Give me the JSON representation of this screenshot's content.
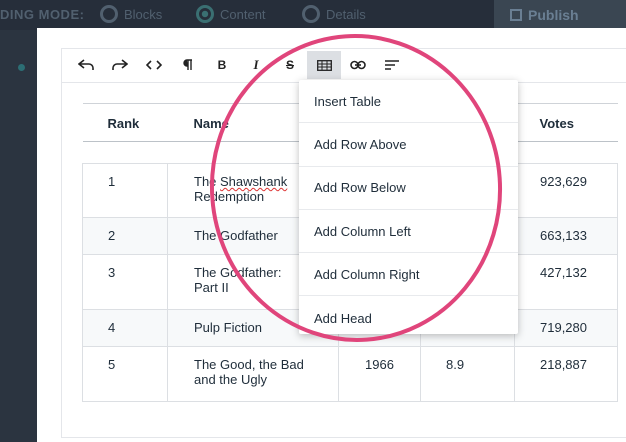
{
  "topbar": {
    "mode_label": "DING MODE:",
    "modes": [
      "Blocks",
      "Content",
      "Details"
    ],
    "publish_label": "Publish"
  },
  "toolbar": {
    "buttons": [
      {
        "name": "undo-icon"
      },
      {
        "name": "redo-icon"
      },
      {
        "name": "code-icon"
      },
      {
        "name": "paragraph-icon"
      },
      {
        "name": "bold-icon",
        "glyph": "B"
      },
      {
        "name": "italic-icon",
        "glyph": "I"
      },
      {
        "name": "strikethrough-icon",
        "glyph": "S"
      },
      {
        "name": "table-icon",
        "active": true
      },
      {
        "name": "link-icon"
      },
      {
        "name": "align-icon"
      }
    ]
  },
  "table": {
    "headers": [
      "Rank",
      "Name",
      "",
      "",
      "Votes"
    ],
    "rows": [
      {
        "rank": "1",
        "name_a": "The ",
        "name_b": "Shawshank",
        "name_c": "Redemption",
        "year": "",
        "rating": "",
        "votes": "923,629"
      },
      {
        "rank": "2",
        "name": "The Godfather",
        "year": "",
        "rating": "",
        "votes": "663,133"
      },
      {
        "rank": "3",
        "name_1": "The Godfather:",
        "name_2": "Part II",
        "year": "",
        "rating": "",
        "votes": "427,132"
      },
      {
        "rank": "4",
        "name": "Pulp Fiction",
        "year": "",
        "rating": "",
        "votes": "719,280"
      },
      {
        "rank": "5",
        "name_1": "The Good, the Bad",
        "name_2": "and the Ugly",
        "year": "1966",
        "rating": "8.9",
        "votes": "218,887"
      }
    ]
  },
  "menu": {
    "items": [
      "Insert Table",
      "Add Row Above",
      "Add Row Below",
      "Add Column Left",
      "Add Column Right",
      "Add Head"
    ]
  },
  "colors": {
    "annotation": "#e0457b",
    "backdrop": "#2b3440"
  }
}
